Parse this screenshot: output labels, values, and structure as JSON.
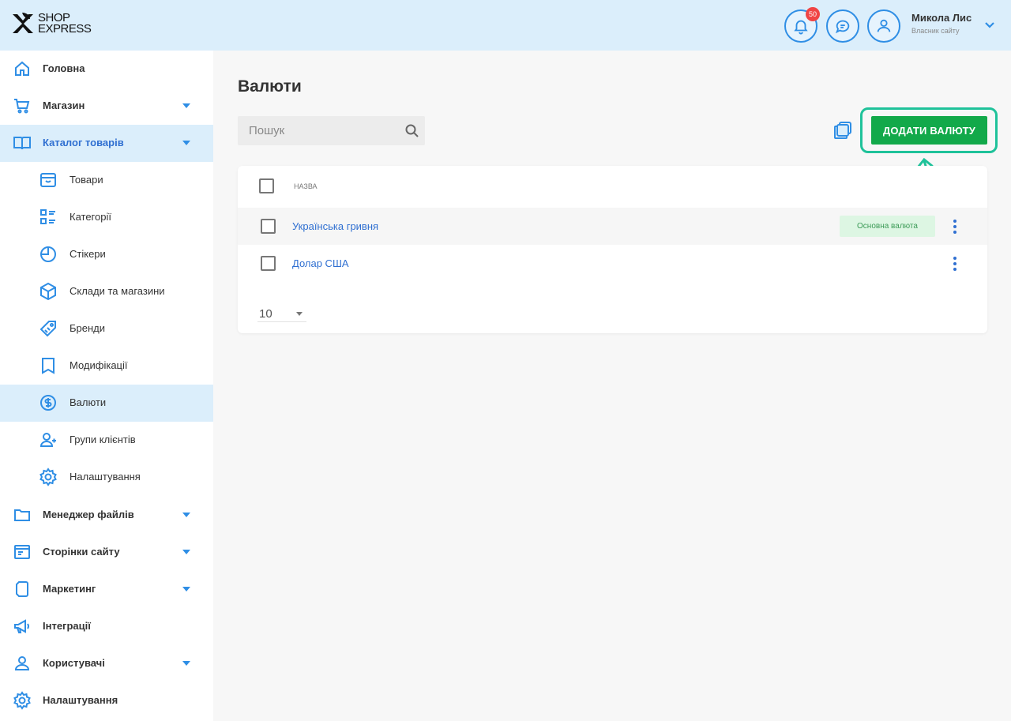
{
  "header": {
    "logo_line1": "SHOP",
    "logo_line2": "EXPRESS",
    "notifications_count": "50",
    "user_name": "Микола Лис",
    "user_role": "Власник сайту"
  },
  "sidebar": {
    "items": [
      {
        "label": "Головна",
        "icon": "home-icon",
        "expandable": false
      },
      {
        "label": "Магазин",
        "icon": "cart-icon",
        "expandable": true
      },
      {
        "label": "Каталог товарів",
        "icon": "book-icon",
        "expandable": true,
        "active": true
      },
      {
        "label": "Товари",
        "icon": "box-icon",
        "sub": true
      },
      {
        "label": "Категорії",
        "icon": "categories-icon",
        "sub": true
      },
      {
        "label": "Стікери",
        "icon": "sticker-icon",
        "sub": true
      },
      {
        "label": "Склади та магазини",
        "icon": "warehouse-icon",
        "sub": true
      },
      {
        "label": "Бренди",
        "icon": "tag-icon",
        "sub": true
      },
      {
        "label": "Модифікації",
        "icon": "bookmark-icon",
        "sub": true
      },
      {
        "label": "Валюти",
        "icon": "dollar-icon",
        "sub": true,
        "active": true
      },
      {
        "label": "Групи клієнтів",
        "icon": "users-icon",
        "sub": true
      },
      {
        "label": "Налаштування",
        "icon": "gear-icon",
        "sub": true
      },
      {
        "label": "Менеджер файлів",
        "icon": "folder-icon",
        "expandable": true
      },
      {
        "label": "Сторінки сайту",
        "icon": "pages-icon",
        "expandable": true
      },
      {
        "label": "Маркетинг",
        "icon": "marketing-icon",
        "expandable": true
      },
      {
        "label": "Інтеграції",
        "icon": "megaphone-icon",
        "expandable": false
      },
      {
        "label": "Користувачі",
        "icon": "user-icon",
        "expandable": true
      },
      {
        "label": "Налаштування",
        "icon": "gear-icon",
        "expandable": false
      }
    ]
  },
  "main": {
    "title": "Валюти",
    "search_placeholder": "Пошук",
    "add_button": "ДОДАТИ ВАЛЮТУ",
    "table": {
      "column_name": "НАЗВА",
      "rows": [
        {
          "name": "Українська гривня",
          "tag": "Основна валюта"
        },
        {
          "name": "Долар США",
          "tag": ""
        }
      ],
      "per_page": "10"
    }
  },
  "colors": {
    "accent": "#2f8ee5",
    "header_bg": "#dbeefb",
    "add_button": "#12a94a",
    "highlight_outline": "#1fc29a"
  }
}
